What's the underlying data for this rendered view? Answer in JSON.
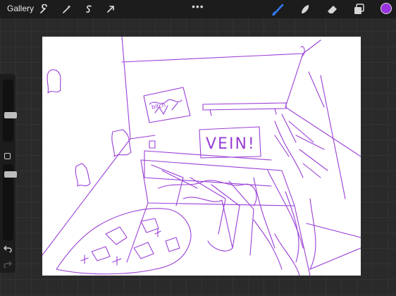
{
  "topbar": {
    "gallery_label": "Gallery",
    "actions_icon": "wrench-icon",
    "adjustments_icon": "magic-wand-icon",
    "selection_icon": "selection-s-icon",
    "transform_icon": "arrow-cursor-icon",
    "more_label": "•••",
    "brush_icon": "brush-icon",
    "smudge_icon": "smudge-icon",
    "eraser_icon": "eraser-icon",
    "layers_icon": "layers-icon",
    "active_color": "#9933e0",
    "accent_color": "#2f7bf5"
  },
  "sidebar": {
    "brush_size": 0.42,
    "opacity": 0.9,
    "undo_icon": "undo-icon",
    "redo_icon": "redo-icon"
  },
  "canvas": {
    "sign_text": "VEIN!",
    "poster_text": "bitch",
    "stroke_color": "#9a3fd6"
  }
}
